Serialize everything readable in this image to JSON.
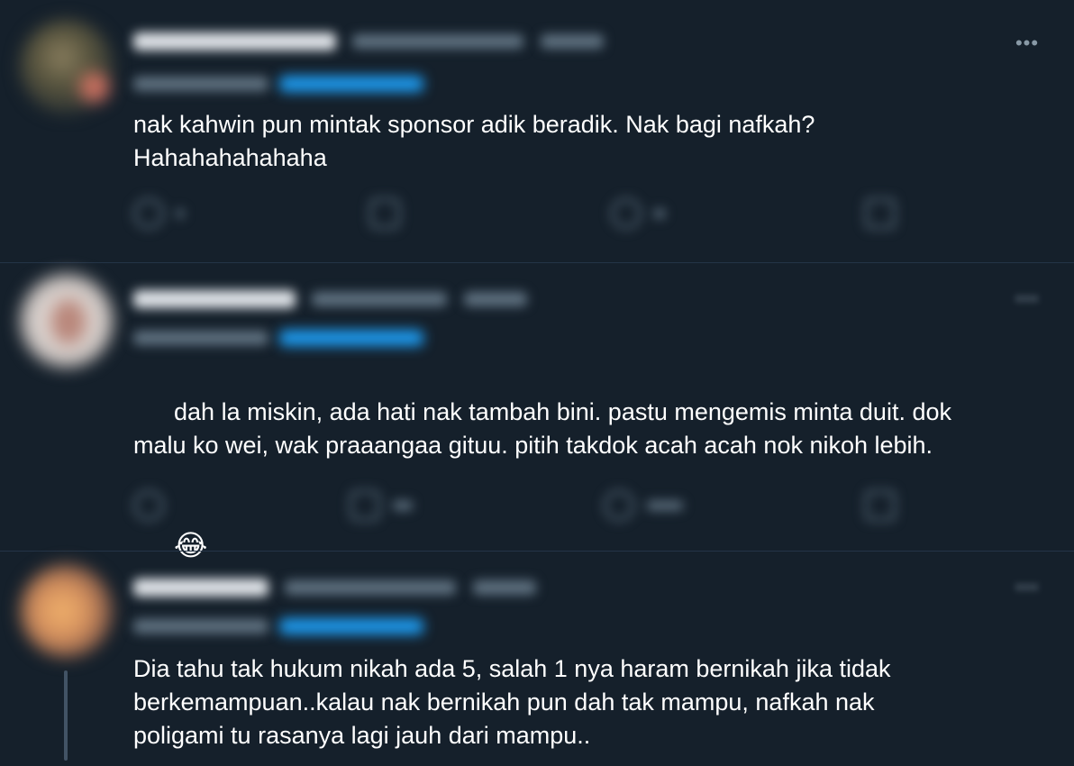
{
  "tweets": [
    {
      "text": "nak kahwin pun mintak sponsor adik beradik. Nak bagi nafkah?\nHahahahahahaha",
      "more_icon": "more-horizontal-icon",
      "more_glyph": "•••"
    },
    {
      "text": "dah la miskin, ada hati nak tambah bini. pastu mengemis minta duit. dok\nmalu ko wei, wak praaangaa gituu. pitih takdok acah acah nok nikoh lebih.",
      "emoji": "😂",
      "more_icon": "more-horizontal-icon",
      "more_glyph": "•••"
    },
    {
      "text": "Dia tahu tak hukum nikah ada 5, salah 1 nya haram bernikah jika tidak\nberkemampuan..kalau nak bernikah pun dah tak mampu, nafkah nak\npoligami tu rasanya lagi jauh dari mampu..",
      "more_icon": "more-horizontal-icon",
      "more_glyph": "•••"
    }
  ],
  "icons": {
    "reply": "reply-icon",
    "retweet": "retweet-icon",
    "like": "like-icon",
    "share": "share-icon"
  },
  "colors": {
    "background": "#15202b",
    "text": "#ffffff",
    "muted": "#8899a6",
    "accent": "#1d9bf0",
    "divider": "#243447"
  }
}
